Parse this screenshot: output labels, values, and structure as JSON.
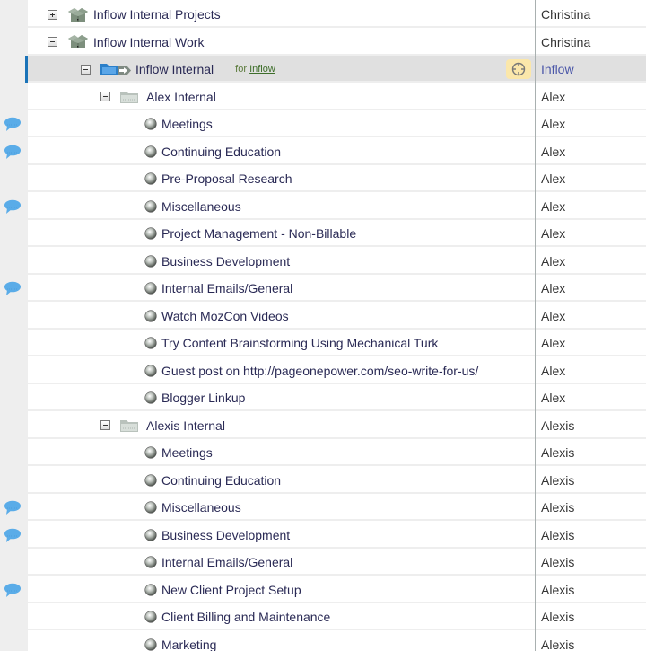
{
  "colors": {
    "selection_accent": "#1a73b8",
    "selected_row_bg": "#e0e0e0",
    "comment_icon": "#5aace8",
    "for_link": "#3d6e2a",
    "target_button_bg": "#fbe7aa"
  },
  "rows": [
    {
      "level": 0,
      "type": "project-group",
      "toggle": "plus",
      "label": "Inflow Internal Projects",
      "owner": "Christina",
      "comment": false
    },
    {
      "level": 0,
      "type": "project-group",
      "toggle": "minus",
      "label": "Inflow Internal Work",
      "owner": "Christina",
      "comment": false
    },
    {
      "level": 1,
      "type": "client-project",
      "toggle": "minus",
      "label": "Inflow Internal",
      "for_prefix": "for",
      "for_link": "Inflow",
      "owner": "Inflow",
      "comment": false,
      "selected": true,
      "target_icon": "target-icon"
    },
    {
      "level": 2,
      "type": "folder",
      "toggle": "minus",
      "label": "Alex Internal",
      "owner": "Alex",
      "comment": false
    },
    {
      "level": 3,
      "type": "task",
      "label": "Meetings",
      "owner": "Alex",
      "comment": true
    },
    {
      "level": 3,
      "type": "task",
      "label": "Continuing Education",
      "owner": "Alex",
      "comment": true
    },
    {
      "level": 3,
      "type": "task",
      "label": "Pre-Proposal Research",
      "owner": "Alex",
      "comment": false
    },
    {
      "level": 3,
      "type": "task",
      "label": "Miscellaneous",
      "owner": "Alex",
      "comment": true
    },
    {
      "level": 3,
      "type": "task",
      "label": "Project Management - Non-Billable",
      "owner": "Alex",
      "comment": false
    },
    {
      "level": 3,
      "type": "task",
      "label": "Business Development",
      "owner": "Alex",
      "comment": false
    },
    {
      "level": 3,
      "type": "task",
      "label": "Internal Emails/General",
      "owner": "Alex",
      "comment": true
    },
    {
      "level": 3,
      "type": "task",
      "label": "Watch MozCon Videos",
      "owner": "Alex",
      "comment": false
    },
    {
      "level": 3,
      "type": "task",
      "label": "Try Content Brainstorming Using Mechanical Turk",
      "owner": "Alex",
      "comment": false
    },
    {
      "level": 3,
      "type": "task",
      "label": "Guest post on http://pageonepower.com/seo-write-for-us/",
      "owner": "Alex",
      "comment": false
    },
    {
      "level": 3,
      "type": "task",
      "label": "Blogger Linkup",
      "owner": "Alex",
      "comment": false
    },
    {
      "level": 2,
      "type": "folder",
      "toggle": "minus",
      "label": "Alexis Internal",
      "owner": "Alexis",
      "comment": false
    },
    {
      "level": 3,
      "type": "task",
      "label": "Meetings",
      "owner": "Alexis",
      "comment": false
    },
    {
      "level": 3,
      "type": "task",
      "label": "Continuing Education",
      "owner": "Alexis",
      "comment": false
    },
    {
      "level": 3,
      "type": "task",
      "label": "Miscellaneous",
      "owner": "Alexis",
      "comment": true
    },
    {
      "level": 3,
      "type": "task",
      "label": "Business Development",
      "owner": "Alexis",
      "comment": true
    },
    {
      "level": 3,
      "type": "task",
      "label": "Internal Emails/General",
      "owner": "Alexis",
      "comment": false
    },
    {
      "level": 3,
      "type": "task",
      "label": "New Client Project Setup",
      "owner": "Alexis",
      "comment": true
    },
    {
      "level": 3,
      "type": "task",
      "label": "Client Billing and Maintenance",
      "owner": "Alexis",
      "comment": false
    },
    {
      "level": 3,
      "type": "task",
      "label": "Marketing",
      "owner": "Alexis",
      "comment": false
    }
  ]
}
